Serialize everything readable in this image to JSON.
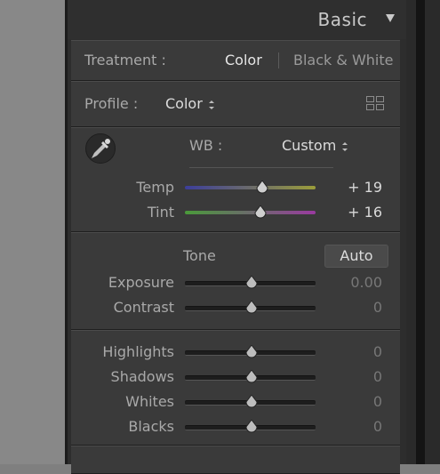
{
  "panel": {
    "title": "Basic"
  },
  "treatment": {
    "label": "Treatment :",
    "color_option": "Color",
    "bw_option": "Black & White"
  },
  "profile": {
    "label": "Profile :",
    "value": "Color"
  },
  "white_balance": {
    "label": "WB :",
    "value": "Custom",
    "temp": {
      "label": "Temp",
      "value": "+ 19",
      "level": 0.59
    },
    "tint": {
      "label": "Tint",
      "value": "+ 16",
      "level": 0.58
    }
  },
  "tone": {
    "label": "Tone",
    "auto_label": "Auto",
    "exposure": {
      "label": "Exposure",
      "value": "0.00",
      "level": 0.5
    },
    "contrast": {
      "label": "Contrast",
      "value": "0",
      "level": 0.5
    }
  },
  "presence": {
    "highlights": {
      "label": "Highlights",
      "value": "0",
      "level": 0.5
    },
    "shadows": {
      "label": "Shadows",
      "value": "0",
      "level": 0.5
    },
    "whites": {
      "label": "Whites",
      "value": "0",
      "level": 0.5
    },
    "blacks": {
      "label": "Blacks",
      "value": "0",
      "level": 0.5
    }
  },
  "icons": [
    "collapse-triangle-icon",
    "eyedropper-icon",
    "profile-browser-grid-icon",
    "spinner-arrows-icon"
  ],
  "colors": {
    "panel_bg": "#3a3a3a",
    "label": "#a9a9a9",
    "value": "#d9d9d9",
    "dim_value": "#777777"
  }
}
